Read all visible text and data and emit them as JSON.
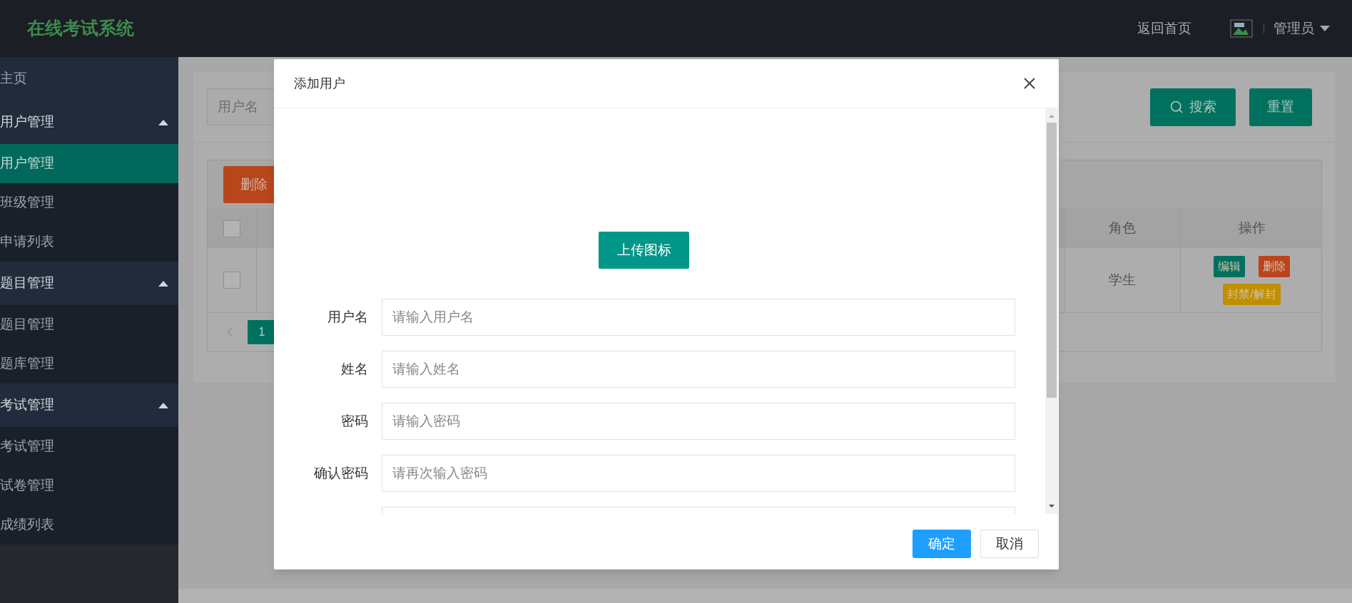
{
  "header": {
    "logo": "在线考试系统",
    "home_link": "返回首页",
    "user": "管理员"
  },
  "sidebar": {
    "items": [
      {
        "label": "主页",
        "selected": false
      },
      {
        "label": "用户管理",
        "expanded": true,
        "children": [
          {
            "label": "用户管理",
            "selected": true
          },
          {
            "label": "班级管理",
            "selected": false
          },
          {
            "label": "申请列表",
            "selected": false
          }
        ]
      },
      {
        "label": "题目管理",
        "expanded": true,
        "children": [
          {
            "label": "题目管理",
            "selected": false
          },
          {
            "label": "题库管理",
            "selected": false
          }
        ]
      },
      {
        "label": "考试管理",
        "expanded": true,
        "children": [
          {
            "label": "考试管理",
            "selected": false
          },
          {
            "label": "试卷管理",
            "selected": false
          },
          {
            "label": "成绩列表",
            "selected": false
          }
        ]
      }
    ]
  },
  "search": {
    "placeholder": "用户名",
    "buttons": [
      {
        "label": "搜索",
        "kind": "search"
      },
      {
        "label": "重置",
        "kind": "plain"
      }
    ]
  },
  "table": {
    "toolbar_button": "删除",
    "header_checked": false,
    "columns": [
      "角色",
      "操作"
    ],
    "rows": [
      {
        "checked": false,
        "role": "学生",
        "actions": [
          {
            "label": "编辑",
            "kind": "edit"
          },
          {
            "label": "删除",
            "kind": "delete"
          },
          {
            "label": "封禁/解封",
            "kind": "ban"
          }
        ]
      }
    ],
    "pages": [
      {
        "label": "1",
        "selected": true
      }
    ]
  },
  "modal": {
    "title": "添加用户",
    "upload_button": "上传图标",
    "fields": [
      {
        "label": "用户名",
        "placeholder": "请输入用户名"
      },
      {
        "label": "姓名",
        "placeholder": "请输入姓名"
      },
      {
        "label": "密码",
        "placeholder": "请输入密码"
      },
      {
        "label": "确认密码",
        "placeholder": "请再次输入密码"
      }
    ],
    "buttons": [
      {
        "label": "确定",
        "kind": "primary"
      },
      {
        "label": "取消",
        "kind": "default"
      }
    ]
  }
}
